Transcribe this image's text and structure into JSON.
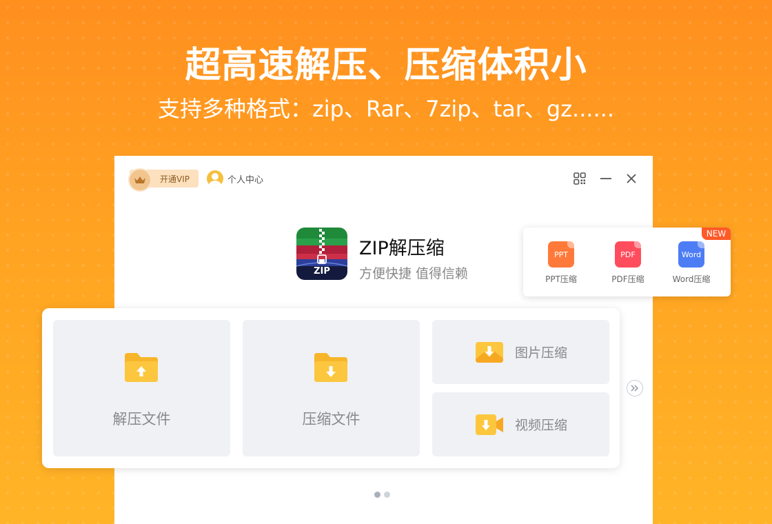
{
  "hero": {
    "title": "超高速解压、压缩体积小",
    "subtitle": "支持多种格式：zip、Rar、7zip、tar、gz......"
  },
  "topbar": {
    "vip_label": "开通VIP",
    "user_center_label": "个人中心"
  },
  "brand": {
    "logo_text": "ZIP",
    "name": "ZIP解压缩",
    "slogan": "方便快捷 值得信赖"
  },
  "tools_popup": {
    "badge": "NEW",
    "items": [
      {
        "icon_text": "PPT",
        "label": "PPT压缩",
        "color": "#ff7a3a"
      },
      {
        "icon_text": "PDF",
        "label": "PDF压缩",
        "color": "#ff4d5e"
      },
      {
        "icon_text": "Word",
        "label": "Word压缩",
        "color": "#4d7df5"
      }
    ]
  },
  "actions": {
    "extract": "解压文件",
    "compress": "压缩文件",
    "image_compress": "图片压缩",
    "video_compress": "视频压缩"
  },
  "pager": {
    "pages": 2,
    "current": 1
  },
  "colors": {
    "accent": "#ff9a22",
    "folder": "#f7bf32"
  }
}
